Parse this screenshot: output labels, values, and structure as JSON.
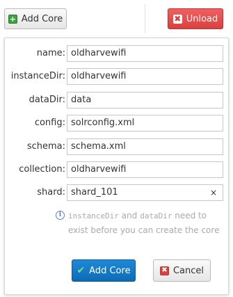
{
  "toolbar": {
    "add_core_label": "Add Core",
    "unload_label": "Unload"
  },
  "form": {
    "fields": [
      {
        "label": "name:",
        "value": "oldharvewifi"
      },
      {
        "label": "instanceDir:",
        "value": "oldharvewifi"
      },
      {
        "label": "dataDir:",
        "value": "data"
      },
      {
        "label": "config:",
        "value": "solrconfig.xml"
      },
      {
        "label": "schema:",
        "value": "schema.xml"
      },
      {
        "label": "collection:",
        "value": "oldharvewifi"
      },
      {
        "label": "shard:",
        "value": "shard_101"
      }
    ],
    "clear_glyph": "×"
  },
  "info": {
    "icon_glyph": "i",
    "code_1": "instanceDir",
    "text_and": " and ",
    "code_2": "dataDir",
    "text_rest": " need to exist before you can create the core"
  },
  "actions": {
    "add_core_label": "Add Core",
    "cancel_label": "Cancel"
  },
  "icons": {
    "plus": "plus-icon",
    "unload": "close-icon",
    "check": "check-icon",
    "cancel": "close-icon",
    "info": "info-icon"
  },
  "colors": {
    "unload_bg": "#d9403e",
    "primary_bg": "#0d6bb6",
    "plus_green": "#3da33d",
    "info_blue": "#5b7fc5"
  }
}
